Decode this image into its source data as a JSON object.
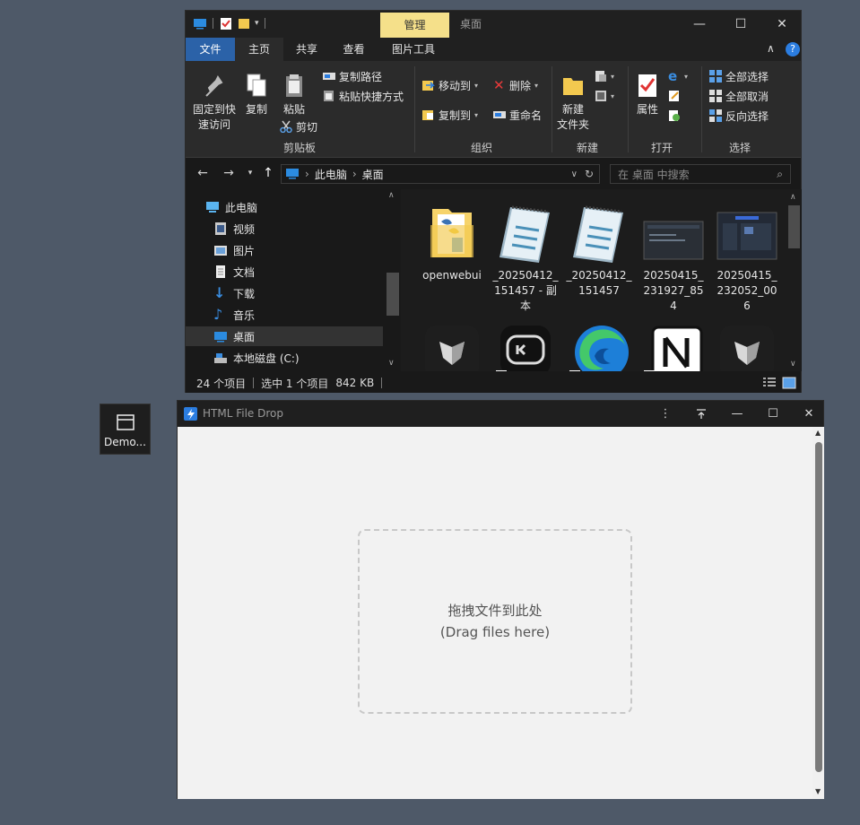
{
  "explorer": {
    "context_tab": "管理",
    "window_title": "桌面",
    "controls": {
      "minimize": "—",
      "maximize": "☐",
      "close": "✕"
    },
    "menu": [
      "文件",
      "主页",
      "共享",
      "查看",
      "图片工具"
    ],
    "ribbon": {
      "clipboard": {
        "pin": "固定到快\n速访问",
        "copy": "复制",
        "paste": "粘贴",
        "copy_path": "复制路径",
        "paste_shortcut": "粘贴快捷方式",
        "cut": "剪切",
        "label": "剪贴板"
      },
      "organize": {
        "move_to": "移动到",
        "copy_to": "复制到",
        "delete": "删除",
        "rename": "重命名",
        "label": "组织"
      },
      "new": {
        "new_folder": "新建\n文件夹",
        "label": "新建"
      },
      "open": {
        "properties": "属性",
        "label": "打开"
      },
      "select": {
        "select_all": "全部选择",
        "select_none": "全部取消",
        "invert": "反向选择",
        "label": "选择"
      }
    },
    "address": {
      "path": [
        "此电脑",
        "桌面"
      ],
      "search_placeholder": "在 桌面 中搜索"
    },
    "tree": [
      {
        "label": "此电脑",
        "icon": "pc-icon",
        "selected": false
      },
      {
        "label": "视频",
        "icon": "video-icon",
        "selected": false
      },
      {
        "label": "图片",
        "icon": "picture-icon",
        "selected": false
      },
      {
        "label": "文档",
        "icon": "document-icon",
        "selected": false
      },
      {
        "label": "下载",
        "icon": "download-icon",
        "selected": false
      },
      {
        "label": "音乐",
        "icon": "music-icon",
        "selected": false
      },
      {
        "label": "桌面",
        "icon": "desktop-icon",
        "selected": true
      },
      {
        "label": "本地磁盘 (C:)",
        "icon": "disk-icon",
        "selected": false
      }
    ],
    "files": [
      {
        "name": "openwebui",
        "icon": "folder-icon"
      },
      {
        "name": "_20250412_\n151457 - 副\n本",
        "icon": "notepad-icon"
      },
      {
        "name": "_20250412_\n151457",
        "icon": "notepad-icon"
      },
      {
        "name": "20250415_\n231927_85\n4",
        "icon": "screenshot-icon"
      },
      {
        "name": "20250415_\n232052_00\n6",
        "icon": "screenshot-icon"
      },
      {
        "name": "",
        "icon": "app-icon"
      },
      {
        "name": "",
        "icon": "app-icon"
      },
      {
        "name": "",
        "icon": "edge-icon"
      },
      {
        "name": "",
        "icon": "notion-icon"
      },
      {
        "name": "",
        "icon": "app-icon"
      }
    ],
    "status": {
      "count": "24 个项目",
      "selection": "选中 1 个项目",
      "size": "842 KB"
    }
  },
  "demo_tile": {
    "label": "Demo..."
  },
  "drop_window": {
    "title": "HTML File Drop",
    "zone_line1": "拖拽文件到此处",
    "zone_line2": "(Drag files here)"
  }
}
